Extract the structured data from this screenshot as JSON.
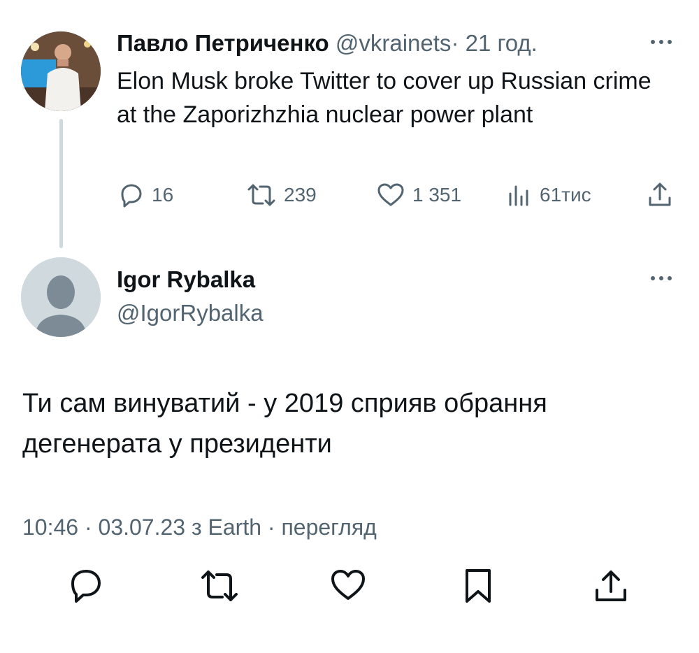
{
  "tweet1": {
    "author_name": "Павло Петриченко",
    "handle": "@vkrainets",
    "separator": "·",
    "time": "21 год.",
    "text": "Elon Musk broke Twitter to cover up Russian crime at the Zaporizhzhia nuclear power plant",
    "actions": {
      "replies": "16",
      "retweets": "239",
      "likes": "1 351",
      "views": "61тис"
    }
  },
  "tweet2": {
    "author_name": "Igor Rybalka",
    "handle": "@IgorRybalka",
    "text": "Ти сам винуватий - у 2019 сприяв обрання дегенерата у президенти",
    "meta": {
      "time": "10:46",
      "date": "03.07.23",
      "source_prefix": "з",
      "source": "Earth",
      "views_label": "перегляд",
      "separator": "·"
    }
  },
  "icons": {
    "reply": "reply-icon",
    "retweet": "retweet-icon",
    "like": "heart-icon",
    "views": "views-icon",
    "share": "share-icon",
    "bookmark": "bookmark-icon",
    "more": "more-icon"
  },
  "colors": {
    "text": "#0f1419",
    "secondary": "#536471",
    "thread_line": "#cfd9de",
    "default_avatar_bg": "#cfd9de",
    "default_avatar_fg": "#7c8b96"
  }
}
